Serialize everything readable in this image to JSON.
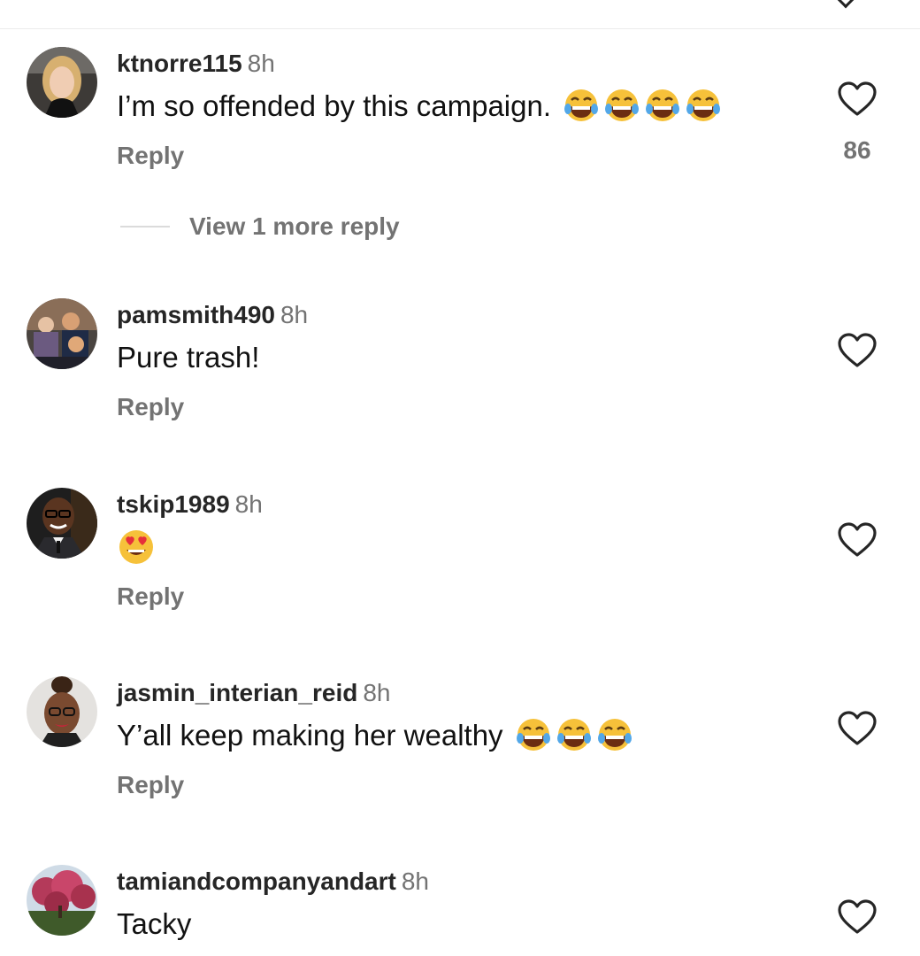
{
  "comments": [
    {
      "username": "ktnorre115",
      "time": "8h",
      "text": "I’m so offended by this campaign.",
      "emojis": [
        "face-with-tears-of-joy",
        "face-with-tears-of-joy",
        "face-with-tears-of-joy",
        "face-with-tears-of-joy"
      ],
      "reply_label": "Reply",
      "likes": "86",
      "view_more_replies": "View 1 more reply"
    },
    {
      "username": "pamsmith490",
      "time": "8h",
      "text": "Pure trash!",
      "emojis": [],
      "reply_label": "Reply"
    },
    {
      "username": "tskip1989",
      "time": "8h",
      "text": "",
      "emojis": [
        "smiling-face-with-heart-eyes"
      ],
      "reply_label": "Reply"
    },
    {
      "username": "jasmin_interian_reid",
      "time": "8h",
      "text": "Y’all keep making her wealthy",
      "emojis": [
        "face-with-tears-of-joy",
        "face-with-tears-of-joy",
        "face-with-tears-of-joy"
      ],
      "reply_label": "Reply"
    },
    {
      "username": "tamiandcompanyandart",
      "time": "8h",
      "text": "Tacky",
      "emojis": []
    }
  ],
  "icons": {
    "like": "heart-outline-icon",
    "collapse": "chevron-down-icon"
  },
  "colors": {
    "username": "#262626",
    "secondary_text": "#737373",
    "divider": "#dbdbdb",
    "emoji_face": "#f6c13a"
  }
}
